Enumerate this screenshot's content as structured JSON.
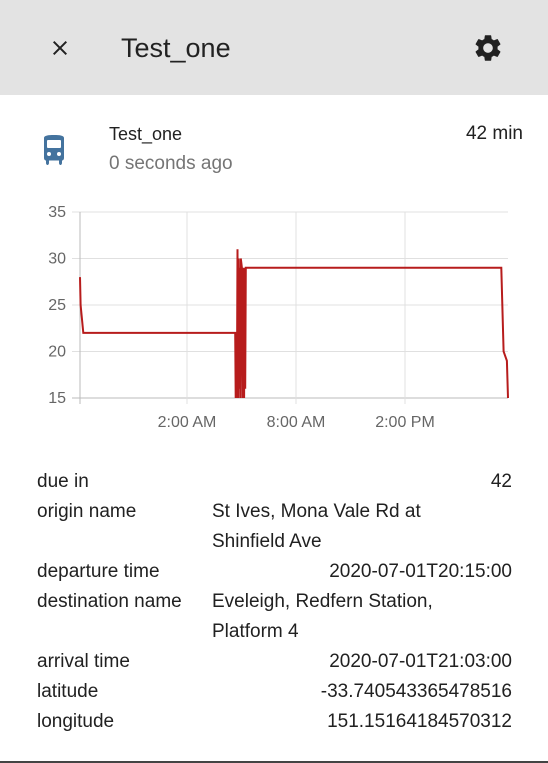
{
  "header": {
    "title": "Test_one",
    "close_icon": "close-icon",
    "settings_icon": "gear-icon"
  },
  "entity": {
    "icon": "bus-icon",
    "icon_color": "#44739e",
    "name": "Test_one",
    "last_changed": "0 seconds ago",
    "state": "42 min"
  },
  "chart_data": {
    "type": "line",
    "series_color": "#b71c1c",
    "ylim": [
      15,
      35
    ],
    "y_ticks": [
      "35",
      "30",
      "25",
      "20",
      "15"
    ],
    "x_ticks": [
      "2:00 AM",
      "8:00 AM",
      "2:00 PM"
    ],
    "grid": true,
    "x": [
      0,
      0.05,
      0.3,
      1.0,
      13.8,
      14.0,
      14.04,
      14.1,
      14.15,
      14.2,
      14.25,
      14.3,
      14.35,
      14.4,
      14.45,
      14.5,
      14.6,
      14.65,
      14.7,
      14.75,
      14.8,
      14.85,
      14.9,
      14.95,
      15.05,
      15.15,
      15.3,
      15.5,
      38.0,
      38.2,
      38.5,
      38.6
    ],
    "values": [
      28,
      25,
      22,
      22,
      22,
      22,
      15,
      22,
      15,
      31,
      15,
      30,
      16,
      29,
      15,
      30,
      29,
      15,
      29,
      24,
      15,
      29,
      16,
      29,
      29,
      29,
      29,
      29,
      29,
      20,
      19,
      15
    ]
  },
  "attributes": [
    {
      "key": "due in",
      "lines": [
        "42"
      ]
    },
    {
      "key": "origin name",
      "lines": [
        "St Ives, Mona Vale Rd at",
        "Shinfield Ave"
      ]
    },
    {
      "key": "departure time",
      "lines": [
        "2020-07-01T20:15:00"
      ]
    },
    {
      "key": "destination name",
      "lines": [
        "Eveleigh, Redfern Station,",
        "Platform 4"
      ]
    },
    {
      "key": "arrival time",
      "lines": [
        "2020-07-01T21:03:00"
      ]
    },
    {
      "key": "latitude",
      "lines": [
        "-33.740543365478516"
      ]
    },
    {
      "key": "longitude",
      "lines": [
        "151.15164184570312"
      ]
    }
  ]
}
